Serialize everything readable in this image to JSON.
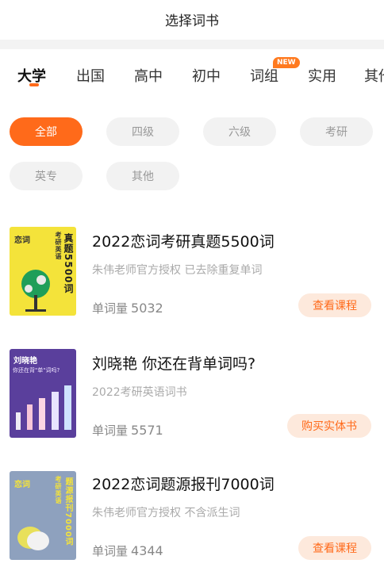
{
  "header": {
    "title": "选择词书"
  },
  "tabs": [
    {
      "label": "大学",
      "active": true
    },
    {
      "label": "出国"
    },
    {
      "label": "高中"
    },
    {
      "label": "初中"
    },
    {
      "label": "词组",
      "badge": "NEW"
    },
    {
      "label": "实用"
    },
    {
      "label": "其他"
    }
  ],
  "filters": [
    "全部",
    "四级",
    "六级",
    "考研",
    "英专",
    "其他"
  ],
  "books": [
    {
      "title": "2022恋词考研真题5500词",
      "subtitle": "朱伟老师官方授权 已去除重复单词",
      "count_label": "单词量",
      "count": "5032",
      "action": "查看课程",
      "cover": {
        "brand": "恋词",
        "vertical": "真题5500词",
        "small": "考研英语"
      }
    },
    {
      "title": "刘晓艳 你还在背单词吗?",
      "subtitle": "2022考研英语词书",
      "count_label": "单词量",
      "count": "5571",
      "action": "购买实体书",
      "cover": {
        "brand": "刘晓艳",
        "small": "你还在背\"单\"词吗?"
      }
    },
    {
      "title": "2022恋词题源报刊7000词",
      "subtitle": "朱伟老师官方授权 不含派生词",
      "count_label": "单词量",
      "count": "4344",
      "action": "查看课程",
      "cover": {
        "brand": "恋词",
        "vertical": "题源报刊7000词",
        "small": "考研英语"
      }
    }
  ],
  "colors": {
    "accent": "#ff6a1a",
    "chip_bg": "#f2f2f2",
    "cover1": "#f4e33a",
    "cover2": "#5a3f9c",
    "cover3": "#8ea1be"
  }
}
